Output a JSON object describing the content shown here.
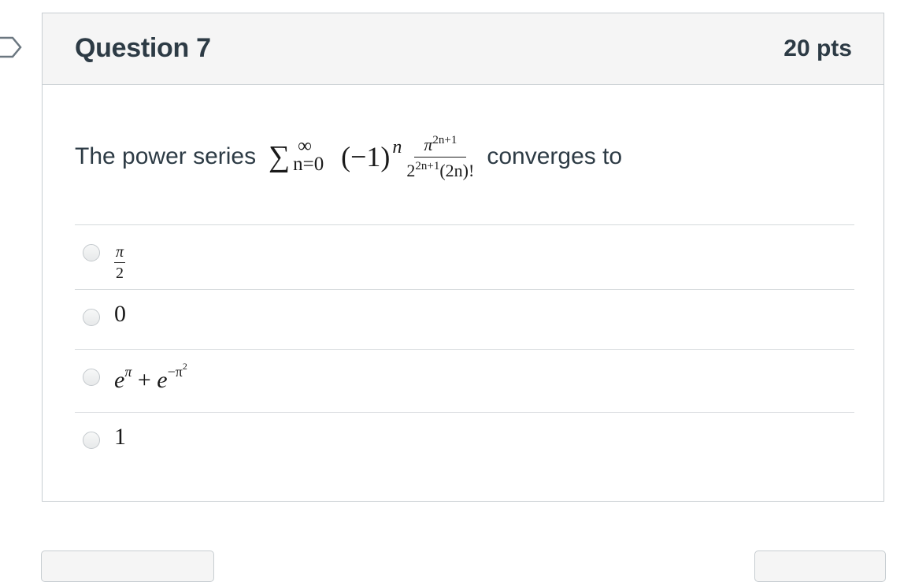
{
  "question": {
    "title": "Question 7",
    "points": "20 pts",
    "text_before": "The power series",
    "text_after": "converges to",
    "formula": {
      "sum_symbol": "∑",
      "upper": "∞",
      "lower": "n=0",
      "base": "(−1)",
      "exponent": "n",
      "numerator_base": "π",
      "numerator_exp": "2n+1",
      "denominator_base": "2",
      "denominator_exp": "2n+1",
      "denominator_tail": "(2n)!"
    }
  },
  "answers": [
    {
      "label_num": "π",
      "label_den": "2"
    },
    {
      "label": "0"
    },
    {
      "label_e1": "e",
      "label_pi": "π",
      "label_plus": "+",
      "label_e2": "e",
      "label_exp": "−π",
      "label_exp2": "2"
    },
    {
      "label": "1"
    }
  ],
  "colors": {
    "text": "#2d3b45",
    "border": "#c7cdd1",
    "header_bg": "#f5f5f5"
  }
}
